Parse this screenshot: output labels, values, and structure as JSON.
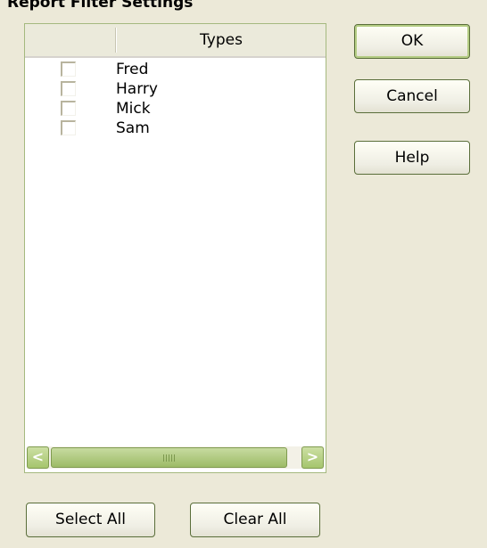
{
  "dialog": {
    "title": "Report Filter Settings"
  },
  "list": {
    "header": {
      "types_label": "Types"
    },
    "items": [
      {
        "label": "Fred",
        "checked": false
      },
      {
        "label": "Harry",
        "checked": false
      },
      {
        "label": "Mick",
        "checked": false
      },
      {
        "label": "Sam",
        "checked": false
      }
    ],
    "scrollbar": {
      "left_glyph": "<",
      "right_glyph": ">"
    }
  },
  "buttons": {
    "ok": "OK",
    "cancel": "Cancel",
    "help": "Help",
    "select_all": "Select All",
    "clear_all": "Clear All"
  },
  "colors": {
    "dialog_bg": "#ECE9D8",
    "accent_green": "#A5C56D",
    "border_green": "#5A6E3A"
  }
}
